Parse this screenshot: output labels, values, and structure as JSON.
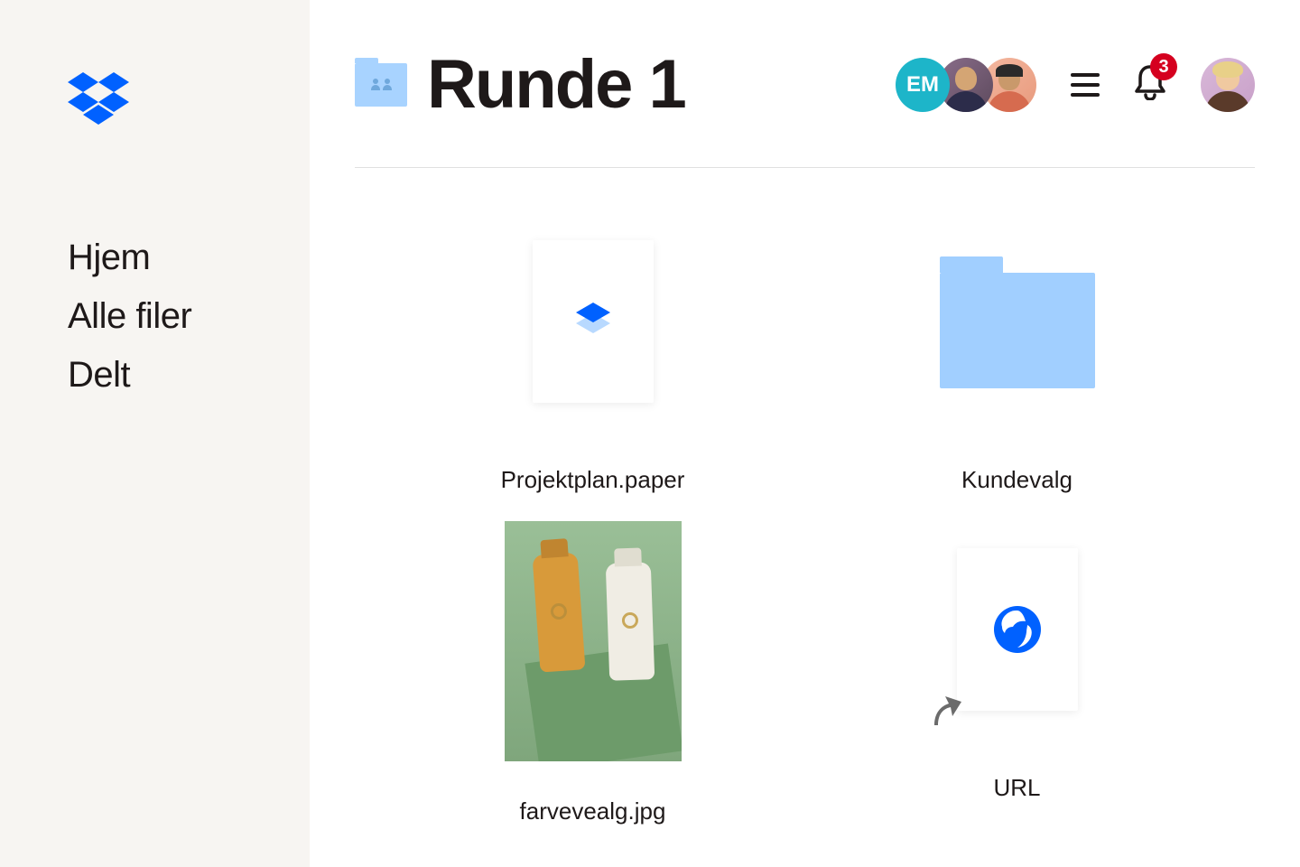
{
  "sidebar": {
    "items": [
      {
        "label": "Hjem"
      },
      {
        "label": "Alle filer"
      },
      {
        "label": "Delt"
      }
    ]
  },
  "header": {
    "title": "Runde 1",
    "collaborators": [
      {
        "initials": "EM",
        "type": "initials"
      },
      {
        "type": "photo"
      },
      {
        "type": "photo"
      }
    ],
    "notification_count": "3"
  },
  "files": [
    {
      "name": "Projektplan.paper",
      "type": "paper"
    },
    {
      "name": "Kundevalg",
      "type": "folder"
    },
    {
      "name": "farvevealg.jpg",
      "type": "image"
    },
    {
      "name": "URL",
      "type": "url"
    }
  ],
  "colors": {
    "brand_blue": "#0061ff",
    "sidebar_bg": "#f7f5f2",
    "folder_blue": "#a1cfff",
    "badge_red": "#d5001f"
  }
}
